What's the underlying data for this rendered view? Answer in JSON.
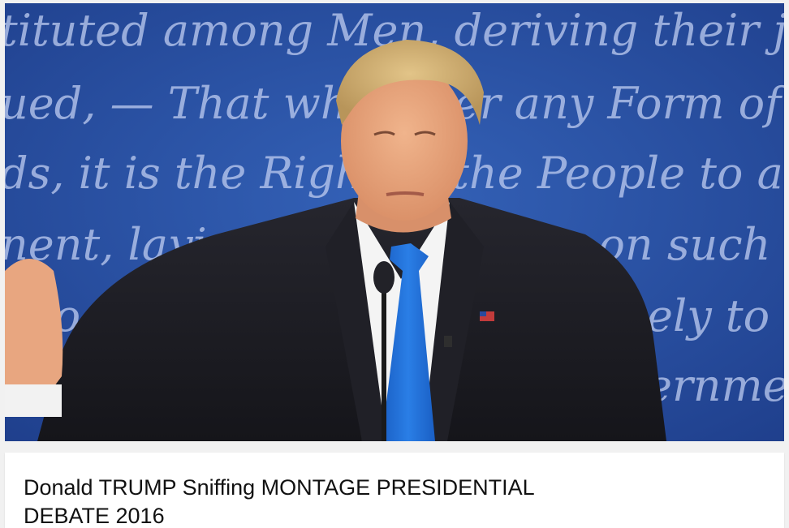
{
  "background_text": {
    "line1": "tituted among Men, deriving their ju",
    "line2": "ued, — That whenever any Form of G",
    "line3": "ds, it is the Right of the People to alter or",
    "line4": "nent, laying its foundation on such princ",
    "line5": "s to them shall seem most likely to effe",
    "line6": "ernmen"
  },
  "video": {
    "title": "Donald TRUMP Sniffing MONTAGE PRESIDENTIAL DEBATE 2016"
  },
  "colors": {
    "backdrop_blue": "#2a52a6",
    "tie_blue": "#1f6fd6",
    "suit": "#1c1c22"
  }
}
